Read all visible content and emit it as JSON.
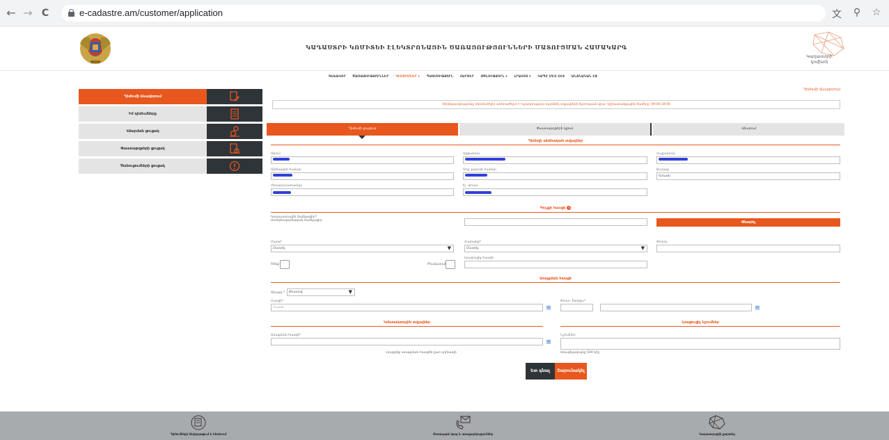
{
  "browser": {
    "url": "e-cadastre.am/customer/application",
    "back_icon": "←",
    "forward_icon": "→",
    "reload_icon": "C",
    "translate_icon": "文",
    "zoom_icon": "⚲",
    "bookmark_icon": "☆"
  },
  "header": {
    "title": "ԿԱԴԱՍՏՐԻ ԿՈՄԻՏԵԻ ԷԼԵԿՏՐՈՆԱՅԻՆ ԾԱՌԱՅՈՒԹՅՈՒՆՆԵՐԻ ՄԱՏՈՒՑՄԱՆ ՀԱՄԱԿԱՐԳ",
    "logo_text_line1": "Կադաստրի",
    "logo_text_line2": "կոմիտե"
  },
  "topmenu": {
    "items": [
      "ԳԼԽԱՎՈՐ",
      "ԾԱՌԱՅՈՒԹՅՈՒՆՆԵՐ",
      "ԴԻՄՈՒՄՆԵՐ ▾",
      "ՊԱՏՄՈՒԹՅՈՒՆ",
      "ՀԱՐՑԵՐ",
      "ՕԳՆՈՒԹՅՈՒՆ ▾",
      "ԼՐԱՀՈՍ ▾",
      "ԿԱՊԸ ՄԵԶ ՀԵՏ",
      "ԱՆՁՆԱԿԱՆ ԷՋ"
    ],
    "active_index": 2
  },
  "sidebar": {
    "items": [
      {
        "label": "Դիմումի ձևավորում",
        "active": true
      },
      {
        "label": "Իմ դիմումները",
        "active": false
      },
      {
        "label": "Վճարման ցուցակ",
        "active": false
      },
      {
        "label": "Փաստաթղթերի ցուցակ",
        "active": false
      },
      {
        "label": "Ծանուցումների ցուցակ",
        "active": false
      }
    ]
  },
  "main": {
    "page_label": "Դիմումի ձևավորում",
    "notice": "Տեղեկատվությունը ներմուծելիս անհրաժեշտ է ուշադրություն դարձնել տվյալների ճշտության վրա: Աշխատանքային ժամերը՝ 09:00-18:00",
    "tabs": [
      "Դիմումի լրացում",
      "Փաստաթղթերի կցում",
      "Վճարում"
    ],
    "sections": {
      "applicant": "Դիմողի անձնական տվյալներ",
      "property": "Գույքի հասցե",
      "delivery": "Առաքման հասցե",
      "contact": "Կոնտակտային տվյալներ",
      "extra": "Լրացուցիչ նշումներ"
    },
    "fields": {
      "name": "Անուն",
      "surname": "Ազգանուն",
      "patronymic": "Հայրանուն",
      "passport": "Անձնագրի համար",
      "ssn": "Սոց. քարտի համար",
      "city": "Քաղաք",
      "city_value": "Երևան",
      "phone": "Հեռախոսահամար",
      "email": "Էլ. փոստ",
      "cadastre_code": "Կադաստրային ծածկագիր*",
      "cadastre_code_hint": "Ստեղծագործական ծածկագիր",
      "search_btn": "Փնտրել",
      "region": "Մարզ*",
      "region_value": "Ընտրել",
      "community": "Համայնք*",
      "community_value": "Ընտրել",
      "street": "Փողոց",
      "building": "Շենք",
      "apartment": "Բնակարան",
      "additional": "Լրացուցիչ հասցե",
      "delivery_type": "Տեսակ *",
      "delivery_type_value": "Փոստով",
      "address": "Հասցե*",
      "address_placeholder": "Հասցե",
      "post_index": "Փոստ. ինդեքս*",
      "delivery_address": "Առաքման հասցե*",
      "delivery_hint": "Լրացրեք առաքման հասցեն ըստ օրինակի",
      "comment": "Նշումներ",
      "comment_hint": "Առավելագույնը 500 նիշ"
    },
    "buttons": {
      "back": "Ետ գնալ",
      "next": "Շարունակել"
    }
  },
  "footer": {
    "items": [
      "Դիմումների ներկայացում և հետևում",
      "Հետադարձ կապ և առաջարկություններ",
      "Կադաստրային քարտեզ"
    ]
  },
  "colors": {
    "accent": "#e8571e",
    "dark": "#2f3439",
    "footer": "#a8abae",
    "scribble": "#3140d8"
  }
}
